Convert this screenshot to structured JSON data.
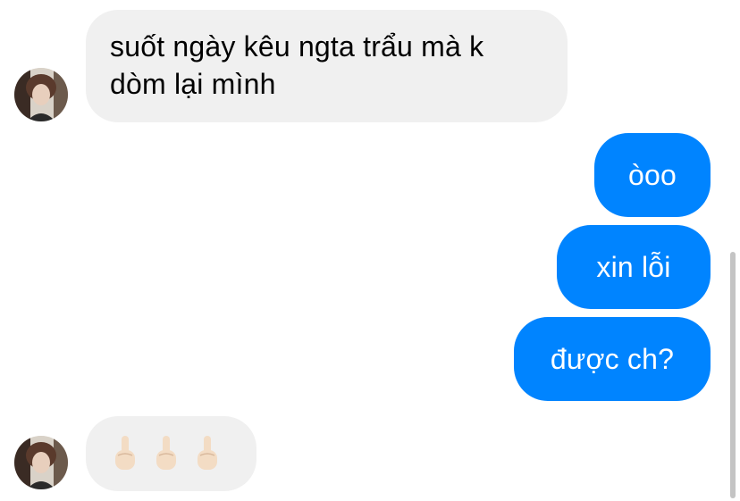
{
  "messages": [
    {
      "side": "incoming",
      "text": "suốt ngày kêu ngta trẩu mà k dòm lại mình",
      "avatar": "contact-avatar"
    },
    {
      "side": "outgoing",
      "text": "òoo"
    },
    {
      "side": "outgoing",
      "text": "xin lỗi"
    },
    {
      "side": "outgoing",
      "text": "được ch?"
    },
    {
      "side": "incoming",
      "emojis": [
        "middle-finger-emoji",
        "middle-finger-emoji",
        "middle-finger-emoji"
      ],
      "avatar": "contact-avatar"
    }
  ],
  "colors": {
    "incoming_bubble": "#f0f0f0",
    "outgoing_bubble": "#0084ff",
    "outgoing_text": "#ffffff",
    "incoming_text": "#000000"
  }
}
